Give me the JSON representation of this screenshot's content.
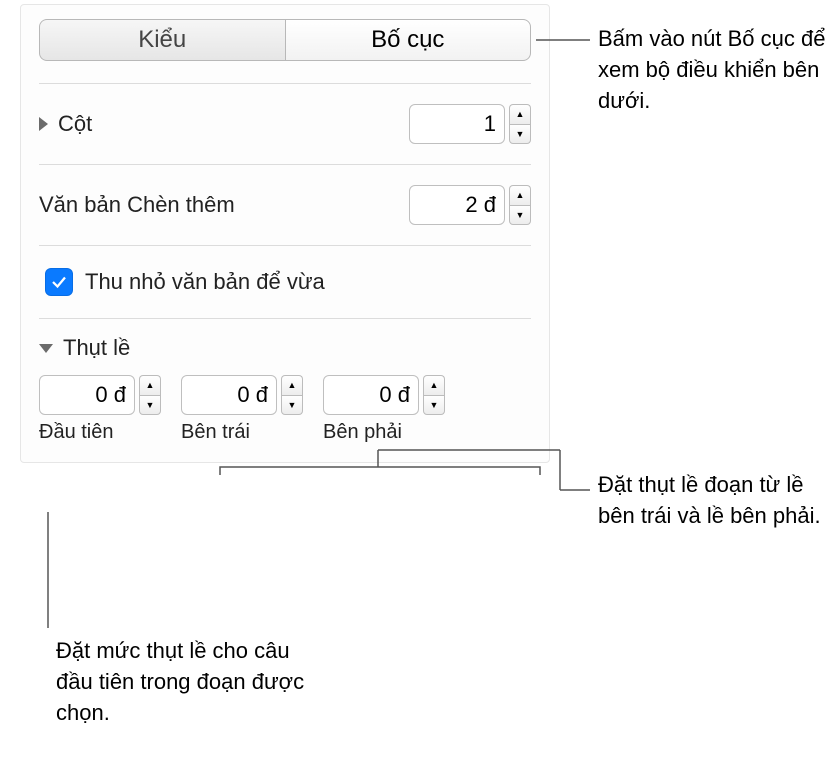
{
  "tabs": {
    "style": "Kiểu",
    "layout": "Bố cục"
  },
  "columns": {
    "label": "Cột",
    "value": "1"
  },
  "inset": {
    "label": "Văn bản Chèn thêm",
    "value": "2 đ"
  },
  "shrink": {
    "label": "Thu nhỏ văn bản để vừa",
    "checked": true
  },
  "indents": {
    "section": "Thụt lề",
    "first": {
      "value": "0 đ",
      "label": "Đầu tiên"
    },
    "left": {
      "value": "0 đ",
      "label": "Bên trái"
    },
    "right": {
      "value": "0 đ",
      "label": "Bên phải"
    }
  },
  "annot": {
    "layoutTab": "Bấm vào nút Bố cục để xem bộ điều khiển bên dưới.",
    "sides": "Đặt thụt lề đoạn từ lề bên trái và lề bên phải.",
    "first": "Đặt mức thụt lề cho câu đầu tiên trong đoạn được chọn."
  }
}
